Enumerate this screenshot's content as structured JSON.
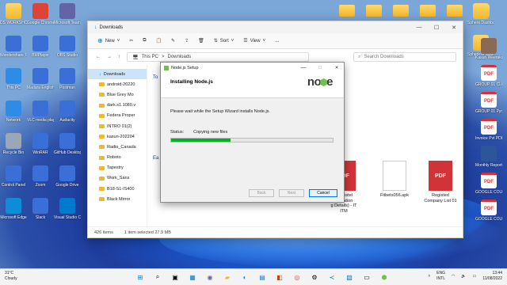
{
  "desktop": {
    "left_icons": [
      {
        "label": "DS WORKSHOP",
        "type": "folder"
      },
      {
        "label": "Google Chrome",
        "type": "chrome"
      },
      {
        "label": "Microsoft Teams (free)",
        "type": "teams"
      },
      {
        "label": "Wondershare Filmora11",
        "type": "app"
      },
      {
        "label": "BMPlayer",
        "type": "app"
      },
      {
        "label": "OBS Studio",
        "type": "app"
      },
      {
        "label": "This PC",
        "type": "pc"
      },
      {
        "label": "Madura English-Sinhala Dictionary",
        "type": "app"
      },
      {
        "label": "Postman",
        "type": "app"
      },
      {
        "label": "Network",
        "type": "net"
      },
      {
        "label": "VLC media player",
        "type": "app"
      },
      {
        "label": "Audacity",
        "type": "app"
      },
      {
        "label": "Recycle Bin",
        "type": "bin"
      },
      {
        "label": "WinRAR",
        "type": "app"
      },
      {
        "label": "GitHub Desktop",
        "type": "app"
      },
      {
        "label": "Control Panel",
        "type": "app"
      },
      {
        "label": "Zoom",
        "type": "app"
      },
      {
        "label": "Google Drive",
        "type": "app"
      },
      {
        "label": "Microsoft Edge",
        "type": "edge"
      },
      {
        "label": "Slack",
        "type": "app"
      },
      {
        "label": "Visual Studio Code",
        "type": "vscode"
      }
    ],
    "right_icons": [
      {
        "label": "Sphere Dashboard",
        "type": "folder"
      },
      {
        "label": "Spherical Solution App",
        "type": "folder"
      },
      {
        "label": "Kasun Weerakoon",
        "type": "person"
      },
      {
        "label": "GROUP 01 CLOUD INCUBATOR",
        "type": "pdf"
      },
      {
        "label": "GROUP 01 Python Eng",
        "type": "pdf"
      },
      {
        "label": "Invoice Pvt PDF",
        "type": "pdf"
      },
      {
        "label": "Monthly Report",
        "type": "word"
      },
      {
        "label": "GOOGLE COURSES",
        "type": "pdf"
      },
      {
        "label": "GOOGLE COURSES 2",
        "type": "pdf"
      }
    ],
    "top_folders_count": 6
  },
  "explorer": {
    "title": "Downloads",
    "toolbar": {
      "new": "New",
      "sort": "Sort",
      "view": "View",
      "more": "..."
    },
    "address": {
      "this_pc": "This PC",
      "sep": ">",
      "current": "Downloads"
    },
    "search_placeholder": "Search Downloads",
    "nav_items": [
      {
        "label": "Downloads",
        "selected": true
      },
      {
        "label": "android-20220"
      },
      {
        "label": "Blue Grey Mo"
      },
      {
        "label": "dark.s1.1080.v"
      },
      {
        "label": "Federa Proper"
      },
      {
        "label": "INTRO 01(2)"
      },
      {
        "label": "kasun-202204"
      },
      {
        "label": "Radio_Canada"
      },
      {
        "label": "Roboto"
      },
      {
        "label": "Tapestry"
      },
      {
        "label": "Work_Sans"
      },
      {
        "label": "B18-S1-IS400"
      },
      {
        "label": "Black Mirror"
      }
    ],
    "section_initials": [
      "To",
      "Ea"
    ],
    "files": [
      {
        "name": "ar Hostel\nmodation\ng Details) - IT\nITM",
        "type": "pdf"
      },
      {
        "name": "Fitbets056.apk",
        "type": "doc"
      },
      {
        "name": "Registed\nCompany List 01",
        "type": "pdf"
      }
    ],
    "status": {
      "items": "426 items",
      "selected": "1 item selected  27.9 MB"
    }
  },
  "dialog": {
    "title": "Node.js Setup",
    "heading": "Installing Node.js",
    "message": "Please wait while the Setup Wizard installs Node.js.",
    "status_label": "Status:",
    "status_value": "Copying new files",
    "progress": 0.37,
    "buttons": {
      "back": "Back",
      "next": "Next",
      "cancel": "Cancel"
    },
    "logo_text": "node"
  },
  "taskbar": {
    "weather_temp": "31°C",
    "weather_desc": "Cloudy",
    "lang": "ENG",
    "lang2": "INTL",
    "time": "13:44",
    "date": "11/08/2022"
  },
  "colors": {
    "accent": "#0078d7",
    "progress": "#06b025",
    "folder": "#f1b82a",
    "pdf": "#d13438",
    "node": "#6cc24a"
  }
}
